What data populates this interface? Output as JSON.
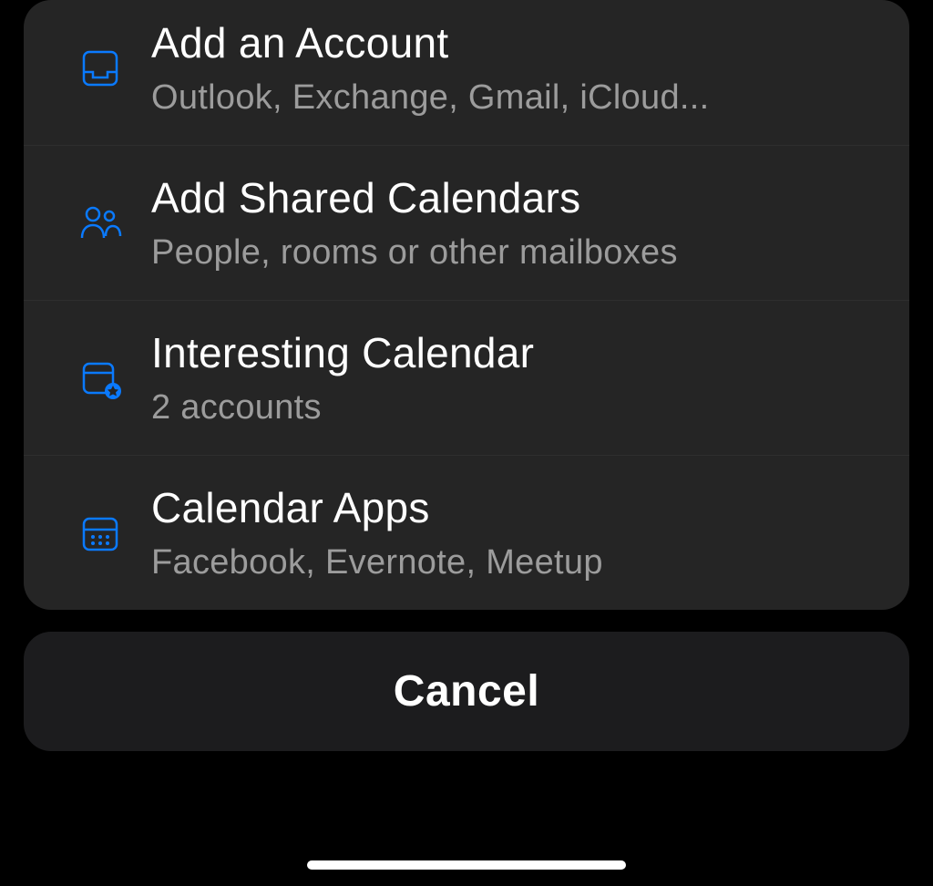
{
  "menu": {
    "items": [
      {
        "title": "Add an Account",
        "subtitle": "Outlook, Exchange, Gmail, iCloud...",
        "icon": "inbox-icon"
      },
      {
        "title": "Add Shared Calendars",
        "subtitle": "People, rooms or other mailboxes",
        "icon": "people-icon"
      },
      {
        "title": "Interesting Calendar",
        "subtitle": "2 accounts",
        "icon": "calendar-star-icon"
      },
      {
        "title": "Calendar Apps",
        "subtitle": "Facebook, Evernote, Meetup",
        "icon": "calendar-grid-icon"
      }
    ]
  },
  "cancel_label": "Cancel",
  "colors": {
    "accent": "#0a7aff",
    "panel_bg": "#252525",
    "cancel_bg": "#1c1c1e",
    "text_primary": "#ffffff",
    "text_secondary": "#9c9c9c"
  }
}
